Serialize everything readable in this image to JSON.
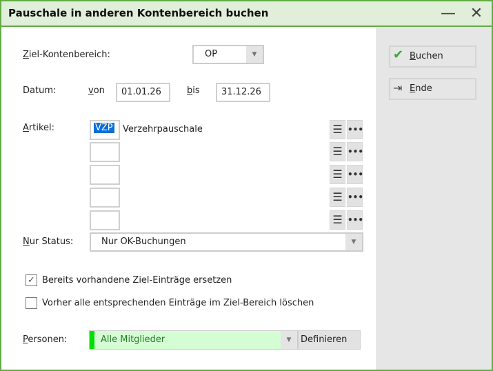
{
  "window": {
    "title": "Pauschale in anderen Kontenbereich buchen"
  },
  "ziel": {
    "label_u": "Z",
    "label_rest": "iel-Kontenbereich:",
    "value": "OP"
  },
  "datum": {
    "label": "Datum:",
    "von_u": "v",
    "von_rest": "on",
    "von_value": "01.01.26",
    "bis_u": "b",
    "bis_rest": "is",
    "bis_value": "31.12.26"
  },
  "artikel": {
    "label_u": "A",
    "label_rest": "rtikel:",
    "rows": [
      {
        "code": "VZP",
        "name": "Verzehrpauschale"
      },
      {
        "code": "",
        "name": ""
      },
      {
        "code": "",
        "name": ""
      },
      {
        "code": "",
        "name": ""
      },
      {
        "code": "",
        "name": ""
      }
    ]
  },
  "status": {
    "label_u": "N",
    "label_rest": "ur Status:",
    "value": "Nur OK-Buchungen"
  },
  "checkboxes": [
    {
      "label": "Bereits vorhandene Ziel-Einträge ersetzen",
      "checked": true
    },
    {
      "label": "Vorher alle entsprechenden Einträge im Ziel-Bereich löschen",
      "checked": false
    }
  ],
  "personen": {
    "label_u": "P",
    "label_rest": "ersonen:",
    "value": "Alle Mitglieder",
    "define": "Definieren"
  },
  "actions": {
    "buchen_u": "B",
    "buchen_rest": "uchen",
    "ende_u": "E",
    "ende_rest": "nde"
  }
}
